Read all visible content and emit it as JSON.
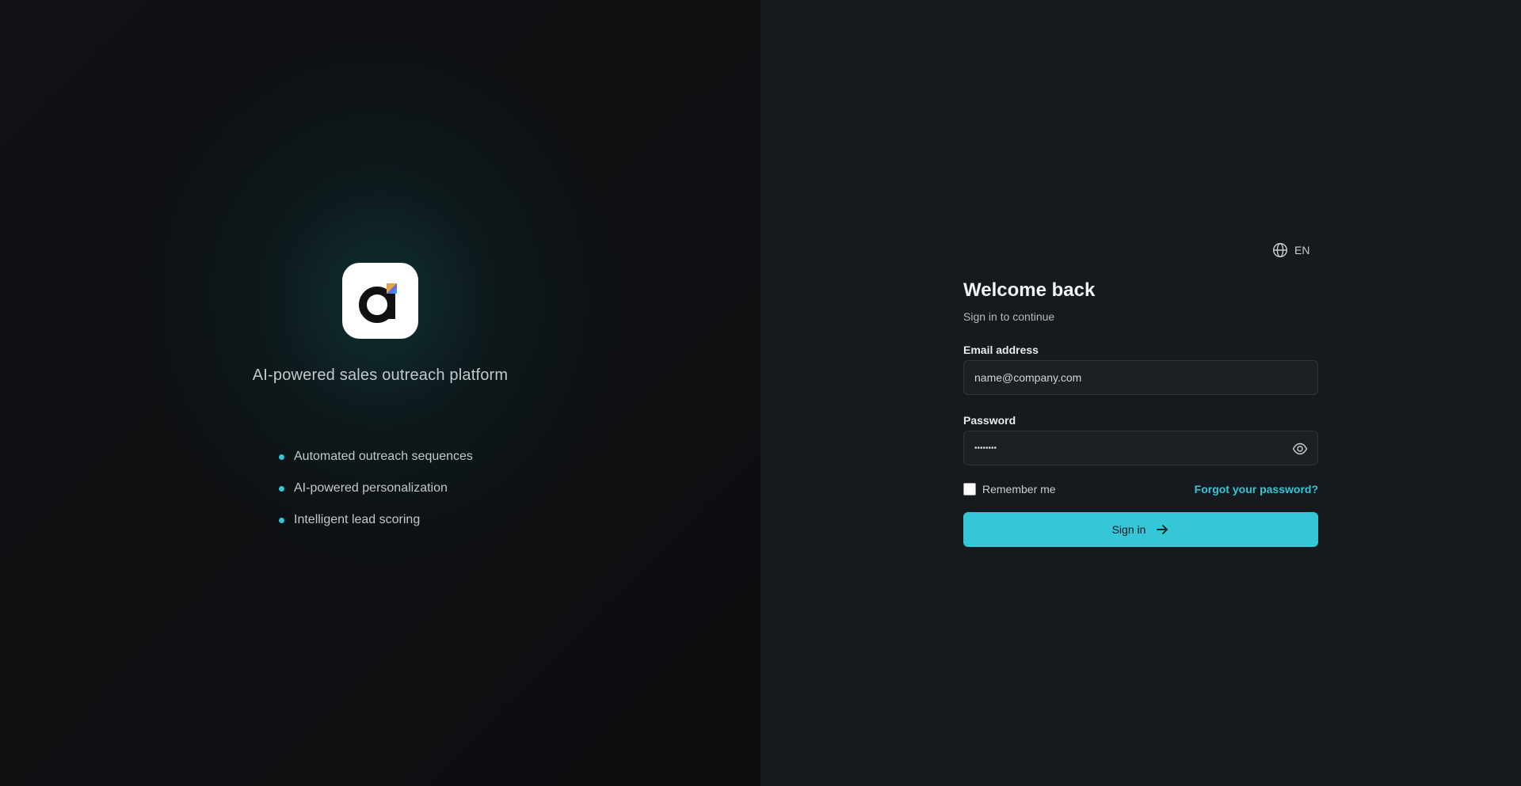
{
  "brand": {
    "tagline": "AI-powered sales outreach platform",
    "accent_color": "#35c6d8",
    "logo_icon": "logo-a-icon"
  },
  "features": [
    {
      "label": "Automated outreach sequences"
    },
    {
      "label": "AI-powered personalization"
    },
    {
      "label": "Intelligent lead scoring"
    }
  ],
  "language": {
    "icon": "globe-icon",
    "label": "EN"
  },
  "form": {
    "title": "Welcome back",
    "subtitle": "Sign in to continue",
    "email": {
      "label": "Email address",
      "placeholder": "name@company.com",
      "value": ""
    },
    "password": {
      "label": "Password",
      "value": "••••••••",
      "toggle_icon": "eye-icon"
    },
    "remember_label": "Remember me",
    "remember_checked": false,
    "forgot_label": "Forgot your password?",
    "submit_label": "Sign in",
    "submit_icon": "arrow-right-icon"
  }
}
